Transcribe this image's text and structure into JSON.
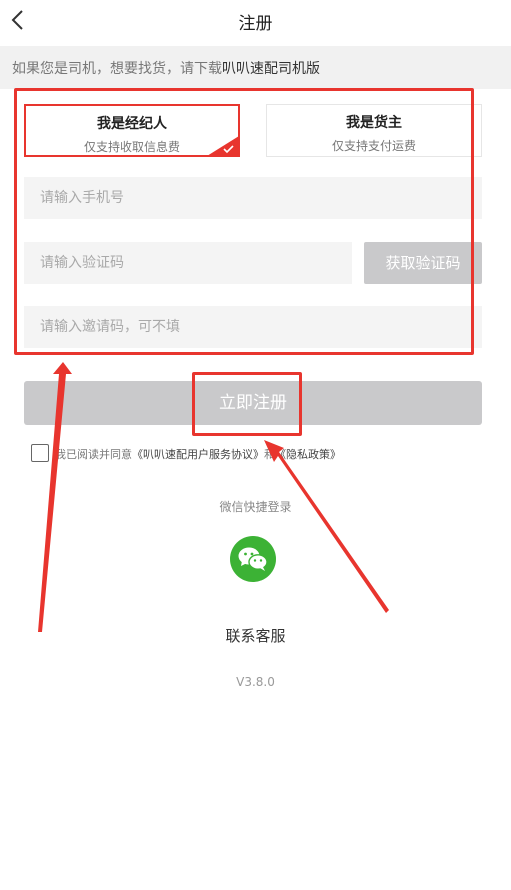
{
  "header": {
    "title": "注册",
    "back_icon": "chevron-left-icon"
  },
  "notice": {
    "text": "如果您是司机，想要找货，请下载",
    "link": "叭叭速配司机版"
  },
  "roles": [
    {
      "title": "我是经纪人",
      "subtitle": "仅支持收取信息费",
      "selected": true
    },
    {
      "title": "我是货主",
      "subtitle": "仅支持支付运费",
      "selected": false
    }
  ],
  "form": {
    "phone_placeholder": "请输入手机号",
    "code_placeholder": "请输入验证码",
    "get_code_label": "获取验证码",
    "invite_placeholder": "请输入邀请码，可不填"
  },
  "register_label": "立即注册",
  "agreement": {
    "prefix": "我已阅读并同意",
    "service_link": "《叭叭速配用户服务协议》",
    "conj": "和",
    "privacy_link": "《隐私政策》"
  },
  "wechat": {
    "label": "微信快捷登录",
    "icon": "wechat-icon"
  },
  "contact_service": "联系客服",
  "version": "V3.8.0",
  "colors": {
    "accent": "#e8352e",
    "disabled_button": "#c9c9cb",
    "wechat": "#3cb235",
    "field_bg": "#f4f4f4"
  }
}
